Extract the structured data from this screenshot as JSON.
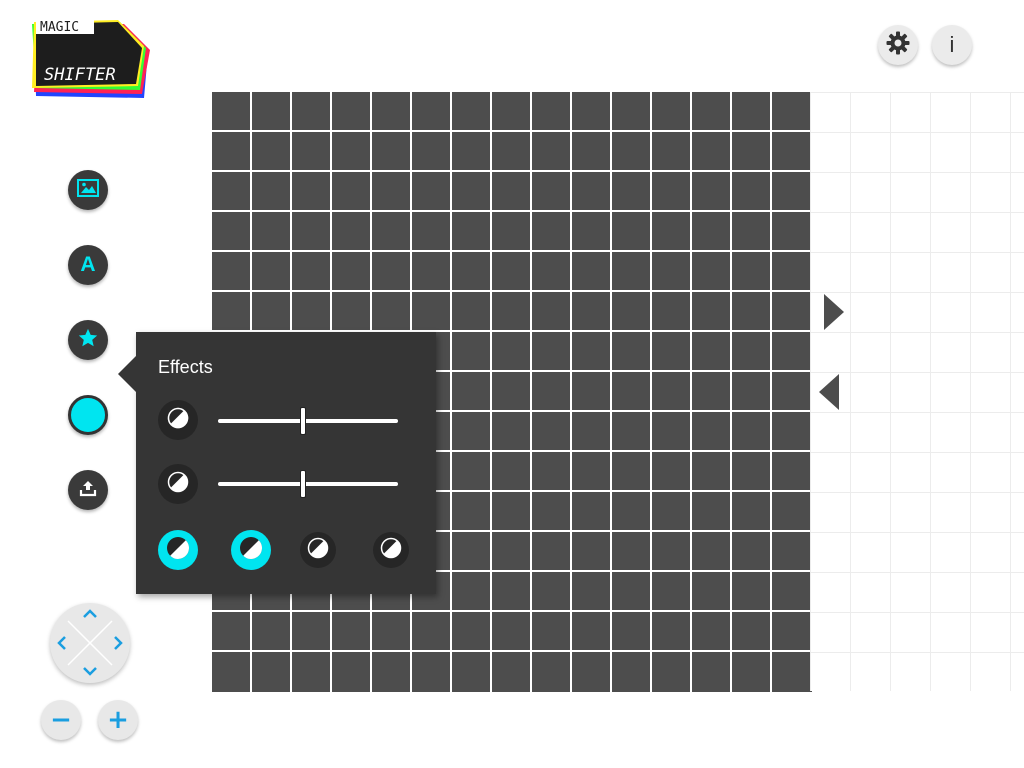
{
  "logo": {
    "line1": "MAGIC",
    "line2": "SHIFTER"
  },
  "header": {
    "settings_icon": "gear-icon",
    "info_label": "i"
  },
  "toolbar": {
    "items": [
      {
        "id": "image",
        "icon": "image-icon"
      },
      {
        "id": "text",
        "icon": "text-icon",
        "label": "A"
      },
      {
        "id": "effects",
        "icon": "star-icon"
      },
      {
        "id": "color",
        "icon": "color-swatch",
        "color": "#00e5f0"
      },
      {
        "id": "upload",
        "icon": "upload-icon"
      }
    ]
  },
  "effects_panel": {
    "title": "Effects",
    "sliders": [
      {
        "icon": "contrast-icon",
        "value": 0.47
      },
      {
        "icon": "contrast-icon",
        "value": 0.47
      }
    ],
    "presets": [
      {
        "icon": "contrast-icon",
        "active": true
      },
      {
        "icon": "contrast-icon",
        "active": true
      },
      {
        "icon": "contrast-icon",
        "active": false
      },
      {
        "icon": "contrast-icon",
        "active": false
      }
    ]
  },
  "canvas": {
    "columns": 15,
    "rows": 15,
    "pixel_color": "#4d4d4d",
    "grid_line_color": "#ffffff"
  },
  "navigation": {
    "next_icon": "triangle-right-icon",
    "prev_icon": "triangle-left-icon"
  },
  "dpad": {
    "directions": [
      "up",
      "down",
      "left",
      "right"
    ]
  },
  "zoom": {
    "out_label": "−",
    "in_label": "+"
  },
  "colors": {
    "accent": "#00e5f0",
    "dark": "#3a3a3a",
    "panel": "#353535",
    "control_blue": "#1a9ee0"
  }
}
